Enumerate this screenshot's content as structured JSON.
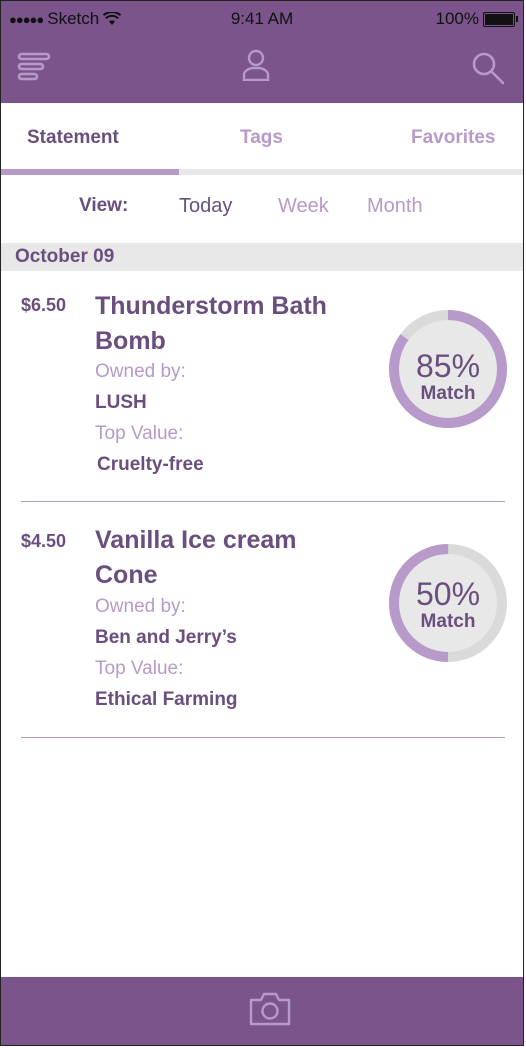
{
  "status_bar": {
    "carrier": "Sketch",
    "time": "9:41 AM",
    "battery": "100%"
  },
  "header": {
    "icons": [
      "menu-icon",
      "profile-icon",
      "search-icon"
    ]
  },
  "tabs": [
    {
      "label": "Statement",
      "active": true
    },
    {
      "label": "Tags",
      "active": false
    },
    {
      "label": "Favorites",
      "active": false
    }
  ],
  "view": {
    "label": "View:",
    "options": [
      "Today",
      "Week",
      "Month"
    ],
    "selected": "Today"
  },
  "date_header": "October 09",
  "items": [
    {
      "price": "$6.50",
      "title_line1": "Thunderstorm Bath",
      "title_line2": "Bomb",
      "owned_label": "Owned by:",
      "owner": "LUSH",
      "value_label": "Top Value:",
      "value": "Cruelty-free",
      "match_pct": "85%",
      "match_label": "Match",
      "match_fraction": 0.85
    },
    {
      "price": "$4.50",
      "title_line1": "Vanilla Ice cream",
      "title_line2": "Cone",
      "owned_label": "Owned by:",
      "owner": "Ben and Jerry’s",
      "value_label": "Top Value:",
      "value": "Ethical Farming",
      "match_pct": "50%",
      "match_label": "Match",
      "match_fraction": 0.5
    }
  ],
  "bottom_bar": {
    "icon": "camera-icon"
  },
  "colors": {
    "brand": "#7a548b",
    "accent": "#b79ac9",
    "text": "#6a4f7e",
    "track": "#e8e8e8"
  }
}
